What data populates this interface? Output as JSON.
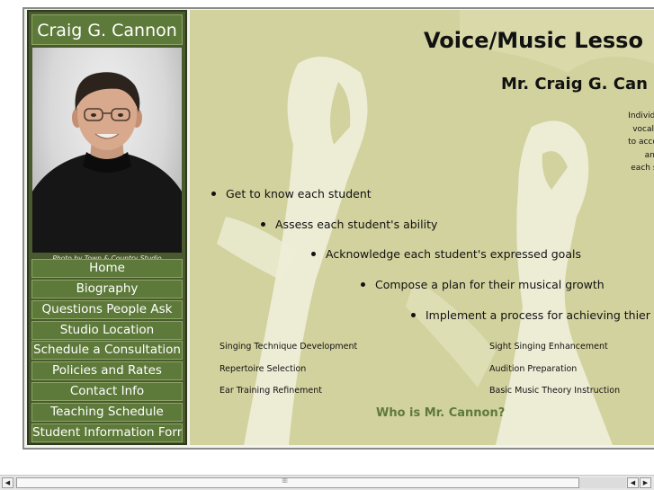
{
  "sidebar": {
    "title": "Craig G. Cannon",
    "photo_credit": "Photo by Town & Country Studio",
    "nav": [
      {
        "label": "Home"
      },
      {
        "label": "Biography"
      },
      {
        "label": "Questions People Ask"
      },
      {
        "label": "Studio Location"
      },
      {
        "label": "Schedule a Consultation"
      },
      {
        "label": "Policies and Rates"
      },
      {
        "label": "Contact Info"
      },
      {
        "label": "Teaching Schedule"
      },
      {
        "label": "Student Information Form"
      }
    ]
  },
  "main": {
    "heading": "Voice/Music Lesso",
    "subheading": "Mr. Craig G. Can",
    "intro_lines": [
      "Individual pro",
      "vocal study",
      "to accomodat",
      "and c",
      "each studen"
    ],
    "goals": [
      "Get to know each student",
      "Assess each student's ability",
      "Acknowledge each student's expressed goals",
      "Compose a plan for their musical growth",
      "Implement a process for achieving thier goal"
    ],
    "services": [
      "Singing Technique Development",
      "Sight Singing Enhancement",
      "Repertoire Selection",
      "Audition Preparation",
      "Ear Training Refinement",
      "Basic Music Theory Instruction"
    ],
    "who_link": "Who is Mr. Cannon?"
  },
  "colors": {
    "sidebar_bg": "#4a5a2f",
    "nav_bg": "#5e7a3a",
    "content_bg": "#d2d29e",
    "link": "#5e7a3a"
  },
  "icons": {
    "scroll_left": "left-arrow-icon",
    "scroll_right": "right-arrow-icon"
  }
}
